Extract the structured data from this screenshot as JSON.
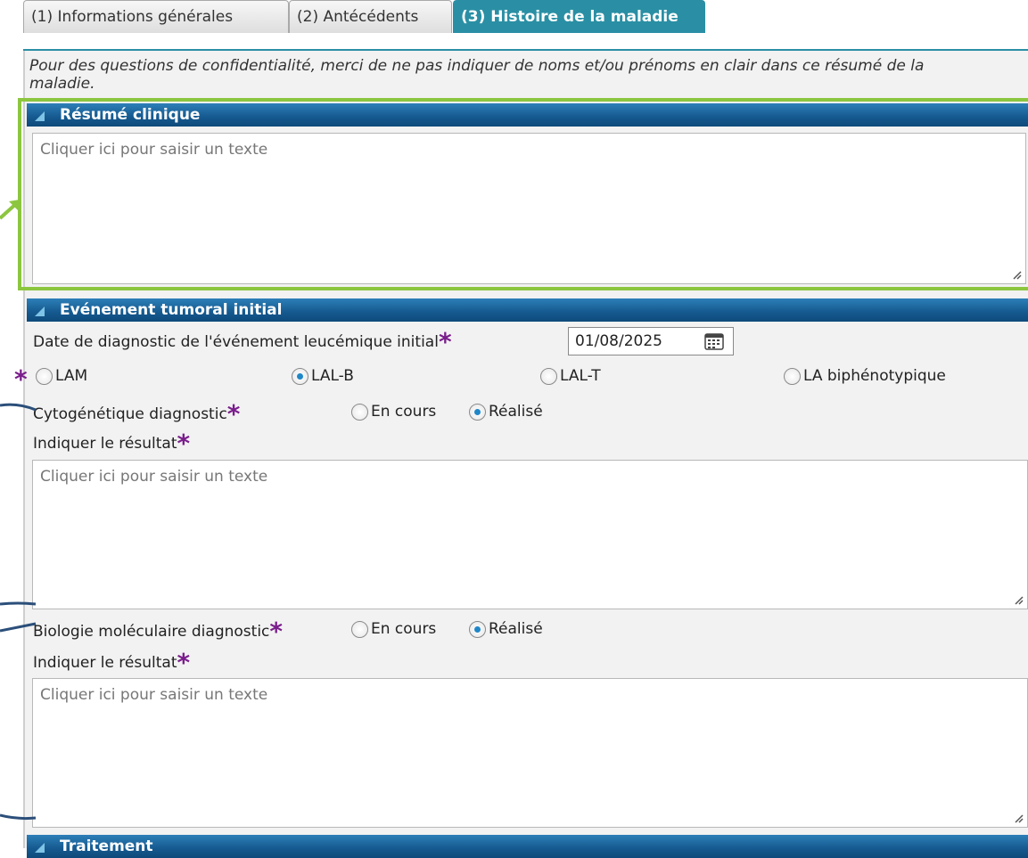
{
  "tabs": [
    {
      "label": "(1) Informations générales"
    },
    {
      "label": "(2) Antécédents"
    },
    {
      "label": "(3) Histoire de la maladie"
    }
  ],
  "note": "Pour des questions de confidentialité, merci de ne pas indiquer de noms et/ou prénoms en clair dans ce résumé de la maladie.",
  "resume": {
    "header": "Résumé clinique",
    "placeholder": "Cliquer ici pour saisir un texte"
  },
  "evenement": {
    "header": "Evénement tumoral initial",
    "date_label": "Date de diagnostic de l'événement leucémique initial",
    "date_value": "01/08/2025",
    "types": [
      {
        "label": "LAM",
        "checked": false
      },
      {
        "label": "LAL-B",
        "checked": true
      },
      {
        "label": "LAL-T",
        "checked": false
      },
      {
        "label": "LA biphénotypique",
        "checked": false
      }
    ],
    "cyto": {
      "label": "Cytogénétique diagnostic",
      "options": [
        {
          "label": "En cours",
          "checked": false
        },
        {
          "label": "Réalisé",
          "checked": true
        }
      ],
      "result_label": "Indiquer le résultat",
      "placeholder": "Cliquer ici pour saisir un texte"
    },
    "bio": {
      "label": "Biologie moléculaire diagnostic",
      "options": [
        {
          "label": "En cours",
          "checked": false
        },
        {
          "label": "Réalisé",
          "checked": true
        }
      ],
      "result_label": "Indiquer le résultat",
      "placeholder": "Cliquer ici pour saisir un texte"
    }
  },
  "traitement": {
    "header": "Traitement"
  },
  "required_mark": "*",
  "colors": {
    "accent_tab": "#2a8fa4",
    "header_blue": "#15598f",
    "required": "#7a1d8c",
    "highlight": "#8cc63f",
    "annotation": "#2b4f7a"
  }
}
